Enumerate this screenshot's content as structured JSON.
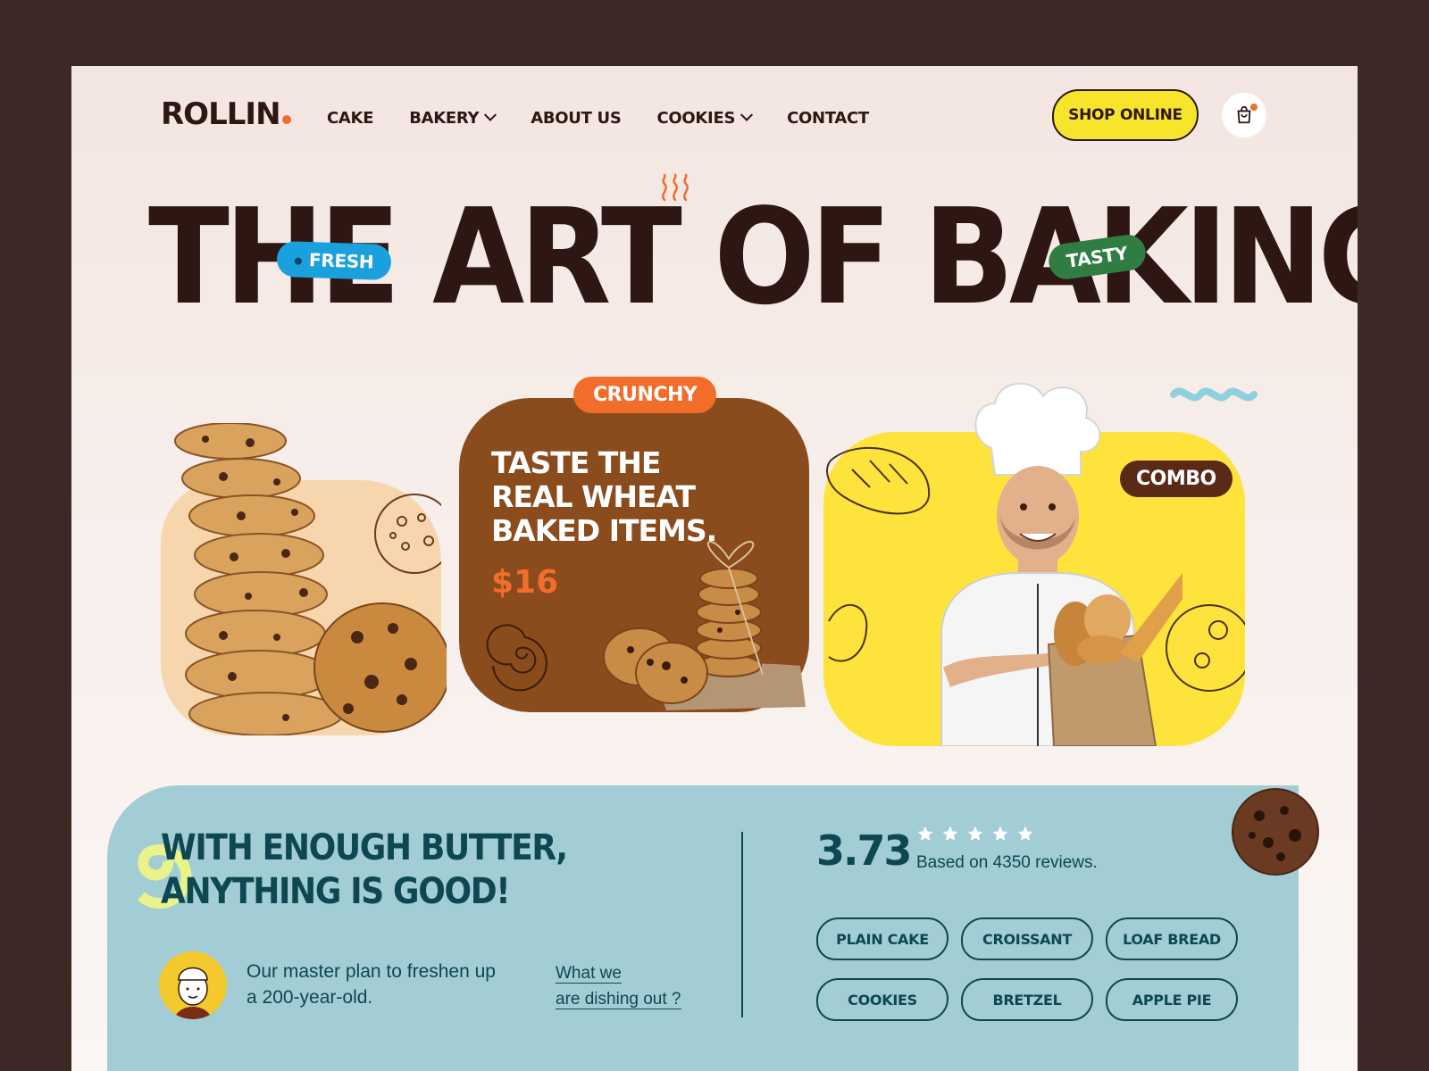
{
  "brand": {
    "name": "ROLLIN",
    "accent": "#f26d2a",
    "dark": "#2e1712"
  },
  "nav": {
    "items": [
      {
        "label": "CAKE",
        "dropdown": false
      },
      {
        "label": "BAKERY",
        "dropdown": true
      },
      {
        "label": "ABOUT US",
        "dropdown": false
      },
      {
        "label": "COOKIES",
        "dropdown": true
      },
      {
        "label": "CONTACT",
        "dropdown": false
      }
    ],
    "shop_label": "SHOP ONLINE",
    "cart_icon": "shopping-bag-icon"
  },
  "hero": {
    "title": "THE ART OF BAKING.",
    "tag_fresh": "FRESH",
    "tag_tasty": "TASTY"
  },
  "cards": {
    "crunchy_tag": "CRUNCHY",
    "headline": "TASTE THE REAL WHEAT BAKED ITEMS.",
    "price": "$16",
    "combo_tag": "COMBO"
  },
  "panel": {
    "motto_line1": "WITH ENOUGH BUTTER,",
    "motto_line2": "ANYTHING IS GOOD!",
    "plan_text": "Our master plan to freshen up a 200-year-old.",
    "link_line1": "What we",
    "link_line2": "are dishing out ?",
    "rating": "3.73",
    "stars": 5,
    "reviews": "Based on 4350 reviews.",
    "chips": [
      "PLAIN CAKE",
      "CROISSANT",
      "LOAF BREAD",
      "COOKIES",
      "BRETZEL",
      "APPLE PIE"
    ]
  },
  "colors": {
    "panel_bg": "#a3cdd4",
    "panel_text": "#0d4752",
    "yellow": "#f6e52a",
    "brown_card": "#8a4b1d",
    "peach_card": "#f7d6ad",
    "fresh_blue": "#1ba0de",
    "tasty_green": "#2f7d43"
  }
}
